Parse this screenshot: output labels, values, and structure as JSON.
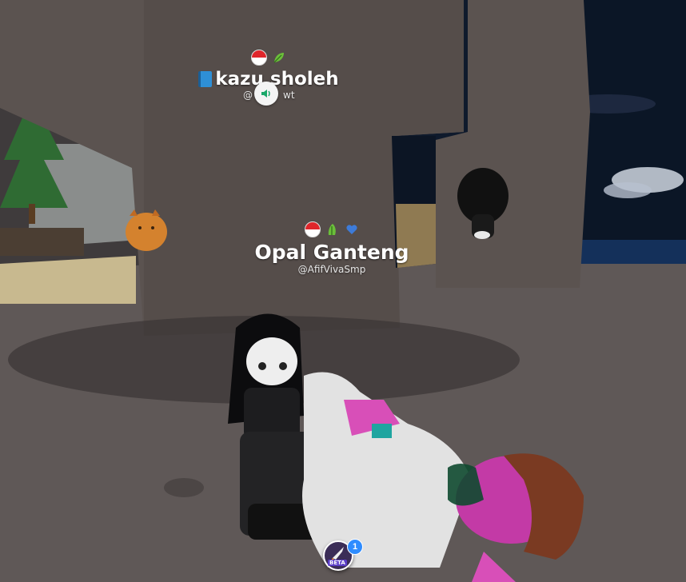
{
  "players": [
    {
      "display_name": "kazu sholeh",
      "username": "@",
      "username_suffix": "wt",
      "badges": [
        "indonesia-flag-badge",
        "leaf-badge"
      ],
      "prefix_icon": "book-icon",
      "voice": "speaker-icon"
    },
    {
      "display_name": "Opal Ganteng",
      "username": "@AfifVivaSmp",
      "badges": [
        "indonesia-flag-badge",
        "leaf-badge",
        "heart-badge"
      ]
    }
  ],
  "beta_button": {
    "label": "BETA",
    "badge_count": "1"
  },
  "colors": {
    "sky": "#0f1a2c",
    "ground": "#5f5857",
    "rock": "#5b5350",
    "water": "#14305a",
    "pink_skin": "#d14fb4",
    "accent_blue": "#2f8cff"
  }
}
